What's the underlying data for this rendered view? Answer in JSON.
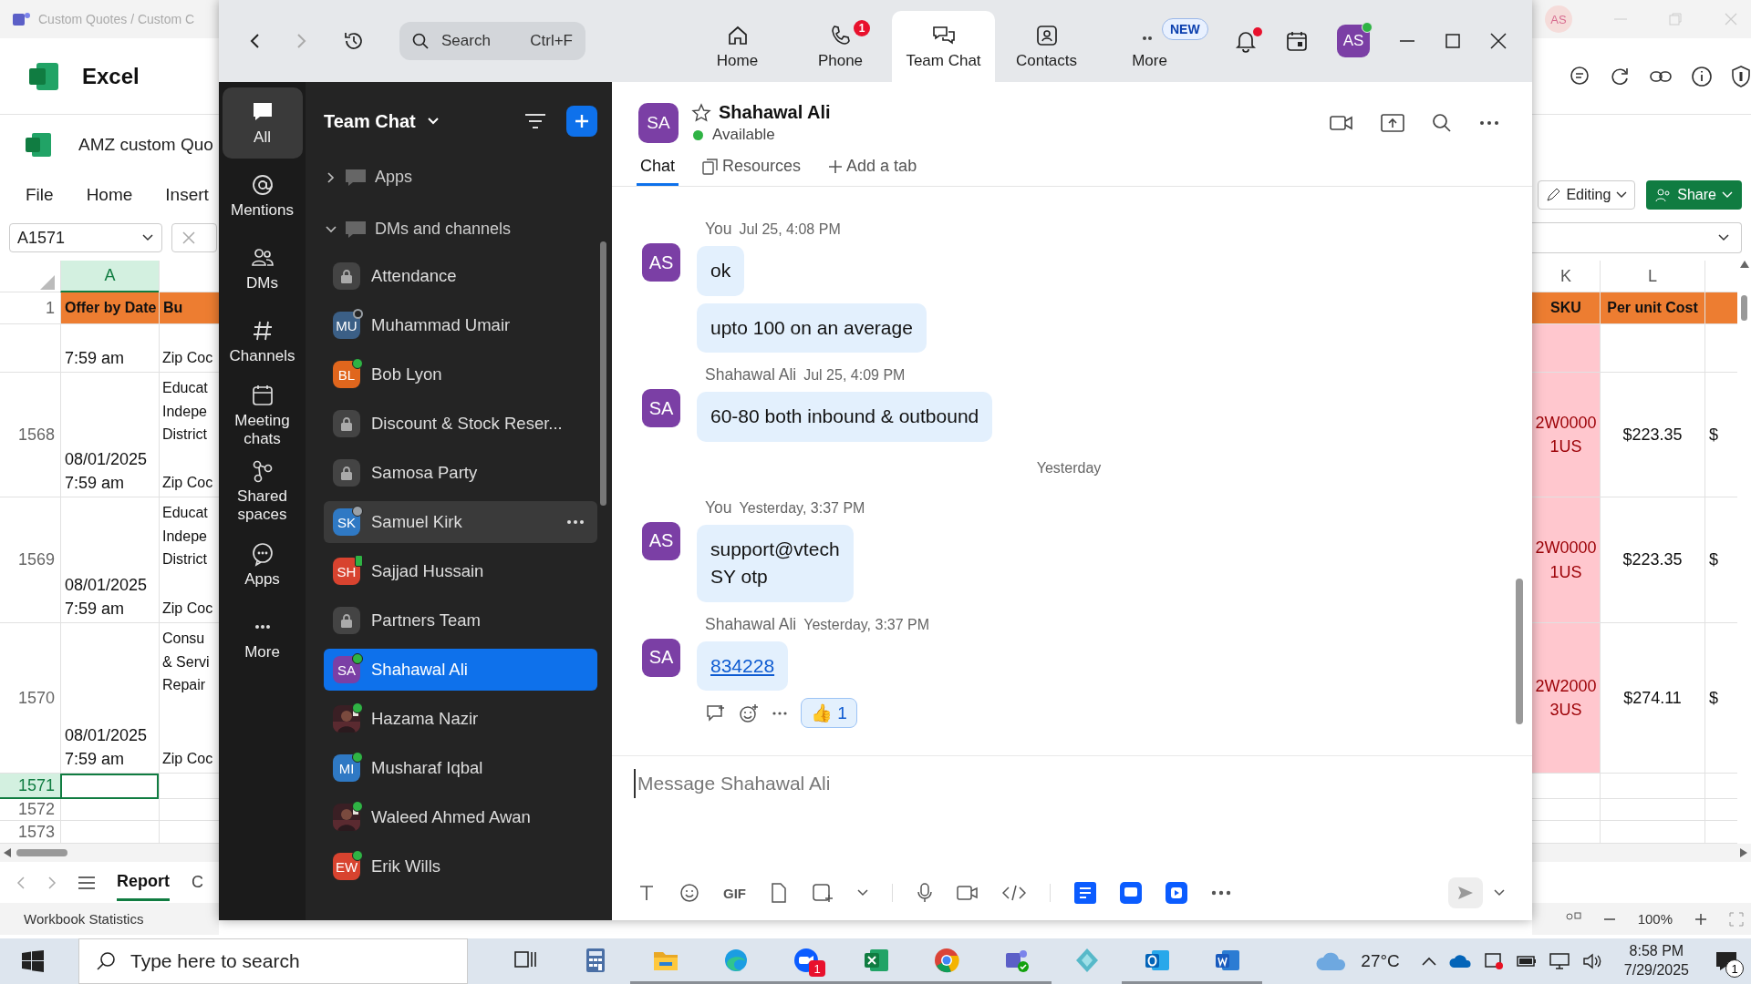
{
  "excel": {
    "title": "Custom Quotes / Custom C",
    "app_name": "Excel",
    "file_name": "AMZ custom Quo",
    "menu": [
      "File",
      "Home",
      "Insert"
    ],
    "name_box": "A1571",
    "account": "AS",
    "editing": "Editing",
    "share": "Share",
    "columns_left": [
      "A"
    ],
    "columns_right": [
      "K",
      "L"
    ],
    "header_row_number": "1",
    "header_left": [
      "Offer by Date",
      "Bu"
    ],
    "header_right": [
      "SKU",
      "Per unit Cost"
    ],
    "rows": [
      {
        "selected": false,
        "time": "7:59 am",
        "zip": "Zip Coc",
        "flagged": true
      },
      {
        "number": "1568",
        "selected": false,
        "date": "08/01/2025",
        "time": "7:59 am",
        "column_b": [
          "Educat",
          "Indepe",
          "District"
        ],
        "zip": "Zip Coc",
        "sku": [
          "2W0000",
          "1US"
        ],
        "cost": "$223.35",
        "column_m": "$",
        "flagged": true
      },
      {
        "number": "1569",
        "selected": false,
        "date": "08/01/2025",
        "time": "7:59 am",
        "column_b": [
          "Educat",
          "Indepe",
          "District"
        ],
        "zip": "Zip Coc",
        "sku": [
          "2W0000",
          "1US"
        ],
        "cost": "$223.35",
        "column_m": "$",
        "flagged": true
      },
      {
        "number": "1570",
        "selected": false,
        "date": "08/01/2025",
        "time": "7:59 am",
        "column_b": [
          "Consu",
          "& Servi",
          "Repair"
        ],
        "zip": "Zip Coc",
        "sku": [
          "2W2000",
          "3US"
        ],
        "cost": "$274.11",
        "column_m": "$",
        "flagged": true
      },
      {
        "number": "1571",
        "selected": true,
        "flagged": false
      },
      {
        "number": "1572",
        "selected": false,
        "flagged": false
      },
      {
        "number": "1573",
        "selected": false,
        "flagged": false
      }
    ],
    "sheet_tabs": [
      {
        "label": "Report",
        "selected": true
      },
      {
        "label": "C",
        "selected": false
      }
    ],
    "status": "Workbook Statistics",
    "zoom": "100%"
  },
  "zoom_app": {
    "search": {
      "placeholder": "Search",
      "shortcut": "Ctrl+F"
    },
    "nav_tabs": [
      {
        "label": "Home",
        "kind": "home",
        "selected": false
      },
      {
        "label": "Phone",
        "kind": "phone",
        "selected": false,
        "badge": "1"
      },
      {
        "label": "Team Chat",
        "kind": "chat",
        "selected": true
      },
      {
        "label": "Contacts",
        "kind": "contacts",
        "selected": false
      },
      {
        "label": "More",
        "kind": "more",
        "selected": false,
        "tag": "NEW"
      }
    ],
    "unread_notifications": true,
    "avatar": "AS",
    "presence": {
      "color": "#2fb344"
    },
    "rail": [
      {
        "label": "All",
        "kind": "chat",
        "selected": true
      },
      {
        "label": "Mentions",
        "kind": "at",
        "selected": false
      },
      {
        "label": "DMs",
        "kind": "people",
        "selected": false
      },
      {
        "label": "Channels",
        "kind": "hash",
        "selected": false
      },
      {
        "label": "Meeting chats",
        "kind": "calendar",
        "selected": false
      },
      {
        "label": "Shared spaces",
        "kind": "share",
        "selected": false
      },
      {
        "label": "Apps",
        "kind": "apps",
        "selected": false
      },
      {
        "label": "More",
        "kind": "more",
        "selected": false
      }
    ],
    "list_title": "Team Chat",
    "sections": [
      {
        "label": "Apps",
        "expanded": false
      },
      {
        "label": "DMs and channels",
        "expanded": true,
        "children": [
          {
            "name": "Attendance",
            "kind": "lock",
            "selected": false,
            "hovered": false
          },
          {
            "name": "Muhammad Umair",
            "kind": "avatar",
            "initials": "MU",
            "color": "#3b5f86",
            "presence": {
              "kind": "ring",
              "color": "#9aa0a6"
            },
            "selected": false,
            "hovered": false
          },
          {
            "name": "Bob Lyon",
            "kind": "avatar",
            "initials": "BL",
            "color": "#e0661d",
            "presence": {
              "kind": "dot",
              "color": "#2fb344"
            },
            "selected": false,
            "hovered": false
          },
          {
            "name": "Discount & Stock Reser...",
            "kind": "lock",
            "selected": false,
            "hovered": false
          },
          {
            "name": "Samosa Party",
            "kind": "lock",
            "selected": false,
            "hovered": false
          },
          {
            "name": "Samuel Kirk",
            "kind": "avatar",
            "initials": "SK",
            "color": "#2f79c4",
            "presence": {
              "kind": "dot",
              "color": "#9aa0a6"
            },
            "selected": false,
            "hovered": true
          },
          {
            "name": "Sajjad Hussain",
            "kind": "avatar",
            "initials": "SH",
            "color": "#d8432f",
            "presence": {
              "kind": "mobile",
              "color": "#2fb344"
            },
            "selected": false,
            "hovered": false
          },
          {
            "name": "Partners Team",
            "kind": "lock",
            "selected": false,
            "hovered": false
          },
          {
            "name": "Shahawal Ali",
            "kind": "avatar",
            "initials": "SA",
            "color": "#7b3fa5",
            "presence": {
              "kind": "dot",
              "color": "#2fb344"
            },
            "selected": true,
            "hovered": false
          },
          {
            "name": "Hazama Nazir",
            "presence": {
              "kind": "dot",
              "color": "#2fb344"
            },
            "selected": false,
            "hovered": false
          },
          {
            "name": "Musharaf Iqbal",
            "kind": "avatar",
            "initials": "MI",
            "color": "#2f79c4",
            "presence": {
              "kind": "dot",
              "color": "#2fb344"
            },
            "selected": false,
            "hovered": false
          },
          {
            "name": "Waleed Ahmed Awan",
            "presence": {
              "kind": "dot",
              "color": "#2fb344"
            },
            "selected": false,
            "hovered": false
          },
          {
            "name": "Erik Wills",
            "kind": "avatar",
            "initials": "EW",
            "color": "#d8432f",
            "presence": {
              "kind": "dot",
              "color": "#2fb344"
            },
            "selected": false,
            "hovered": false
          }
        ]
      }
    ],
    "chat": {
      "contact": {
        "initials": "SA",
        "name": "Shahawal Ali",
        "status": "Available",
        "presence": {
          "color": "#2fb344"
        },
        "starred": false
      },
      "tabs": [
        {
          "label": "Chat",
          "kind": "chat",
          "selected": true
        },
        {
          "label": "Resources",
          "kind": "resources",
          "selected": false
        },
        {
          "label": "Add a tab",
          "kind": "add",
          "selected": false
        }
      ],
      "messages": [
        {
          "kind": "group",
          "sender": "You",
          "time": "Jul 25, 4:08 PM",
          "initials": "AS",
          "bubbles": [
            "ok",
            "upto 100 on an average"
          ]
        },
        {
          "kind": "group",
          "sender": "Shahawal Ali",
          "time": "Jul 25, 4:09 PM",
          "initials": "SA",
          "bubbles": [
            "60-80 both inbound & outbound"
          ]
        },
        {
          "kind": "divider",
          "label": "Yesterday"
        },
        {
          "kind": "group",
          "sender": "You",
          "time": "Yesterday, 3:37 PM",
          "initials": "AS",
          "bubbles": [
            "support@vtech\nSY otp"
          ]
        },
        {
          "kind": "group",
          "sender": "Shahawal Ali",
          "time": "Yesterday, 3:37 PM",
          "initials": "SA",
          "link": "834228",
          "reactions": [
            {
              "emoji": "👍",
              "count": "1"
            }
          ]
        }
      ],
      "composer": {
        "placeholder": "Message Shahawal Ali",
        "gif": "GIF"
      }
    }
  },
  "taskbar": {
    "search_placeholder": "Type here to search",
    "apps": [
      {
        "kind": "taskview",
        "running": false
      },
      {
        "kind": "calculator",
        "running": false
      },
      {
        "kind": "folder",
        "running": true
      },
      {
        "kind": "edge",
        "running": true
      },
      {
        "kind": "zoom",
        "running": true,
        "badge": "1"
      },
      {
        "kind": "excel",
        "running": true
      },
      {
        "kind": "chrome",
        "running": true
      },
      {
        "kind": "teams",
        "running": true
      },
      {
        "kind": "diamond",
        "running": false
      },
      {
        "kind": "outlook",
        "running": true
      },
      {
        "kind": "word",
        "running": true
      }
    ],
    "temperature": "27°C",
    "time": "8:58 PM",
    "date": "7/29/2025",
    "notifications": "1"
  }
}
